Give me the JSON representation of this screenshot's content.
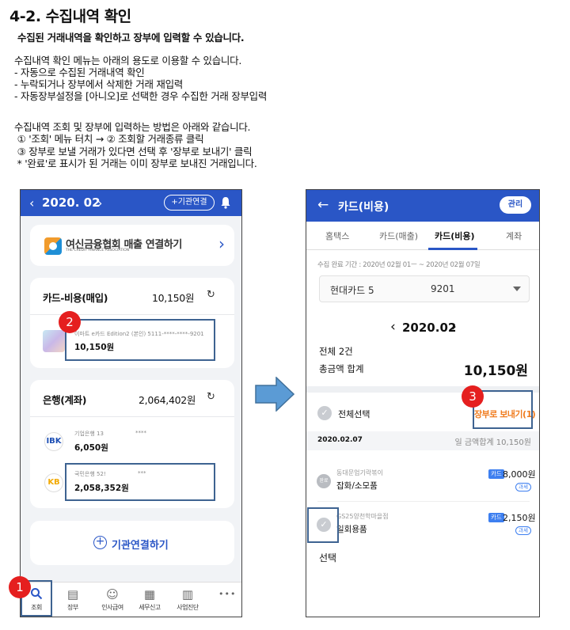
{
  "doc": {
    "title": "4-2. 수집내역 확인",
    "subtitle": "수집된 거래내역을 확인하고 장부에 입력할 수 있습니다.",
    "usage": [
      "수집내역 확인 메뉴는 아래의 용도로 이용할 수 있습니다.",
      "- 자동으로 수집된 거래내역 확인",
      "- 누락되거나 장부에서 삭제한 거래 재입력",
      "- 자동장부설정을 [아니오]로 선택한 경우 수집한 거래 장부입력"
    ],
    "method": [
      "수집내역 조회 및 장부에 입력하는 방법은 아래와 같습니다.",
      " ① '조회' 메뉴 터치 → ② 조회할 거래종류 클릭",
      " ③ 장부로 보낼 거래가 있다면 선택 후 '장부로 보내기' 클릭",
      " * '완료'로 표시가 된 거래는 이미 장부로 보내진 거래입니다."
    ]
  },
  "left_phone": {
    "header": {
      "prev_icon": "chevron-left-icon",
      "month": "2020. 02",
      "next_icon": "chevron-right-icon",
      "connect_label": "+기관연결",
      "bell_icon": "bell-icon"
    },
    "banner": {
      "text": "여신금융협회 매출 연결하기",
      "sub": "THE CREDIT FINANCE ASSOCIATION",
      "chevron": "›"
    },
    "card_section": {
      "title": "카드-비용(매입)",
      "amount": "10,150원",
      "refresh": "↻",
      "item": {
        "name": "이마트 e카드 Edition2 (본인) 5111-****-****-9201",
        "amount": "10,150원"
      }
    },
    "bank_section": {
      "title": "은행(계좌)",
      "amount": "2,064,402원",
      "refresh": "↻",
      "items": [
        {
          "name": "기업은행 13",
          "masked": "****",
          "amount": "6,050원",
          "logo": "IBK"
        },
        {
          "name": "국민은행 52!",
          "masked": "***",
          "amount": "2,058,352원",
          "logo": "KB"
        }
      ]
    },
    "add_button": {
      "icon": "+",
      "label": "기관연결하기"
    },
    "bottom_nav": [
      {
        "label": "조회",
        "icon": "⚲"
      },
      {
        "label": "장부",
        "icon": "▤"
      },
      {
        "label": "인사급여",
        "icon": "☺"
      },
      {
        "label": "세무신고",
        "icon": "▦"
      },
      {
        "label": "사업진단",
        "icon": "▥"
      },
      {
        "label": "",
        "icon": "•••"
      }
    ],
    "steps": [
      "1",
      "2"
    ]
  },
  "right_phone": {
    "header": {
      "back": "←",
      "title": "카드(비용)",
      "manage": "관리"
    },
    "tabs": [
      "홈택스",
      "카드(매출)",
      "카드(비용)",
      "계좌"
    ],
    "active_tab": 2,
    "period": "수집 완료 기간 : 2020년 02월 01ㅡ ~ 2020년 02월 07일",
    "card_select": {
      "name": "현대카드 5",
      "number": "9201"
    },
    "month": {
      "prev": "‹",
      "value": "2020.02",
      "next": "›"
    },
    "total_count": "전체 2건",
    "total_amount_label": "총금액 합계",
    "total_amount": "10,150원",
    "select_all": "전체선택",
    "send_button": "장부로 보내기(1)",
    "date_row": {
      "date": "2020.02.07",
      "summary": "일 금액합계 10,150원"
    },
    "transactions": [
      {
        "badge": "완료",
        "merchant": "동대문업기락볶이",
        "category": "잡화/소모품",
        "card": "카드",
        "amount": "8,000원",
        "tax": "과세"
      },
      {
        "badge": "✓",
        "merchant": "GS25양천학마을점",
        "category": "일회용품",
        "card": "카드",
        "amount": "2,150원",
        "tax": "과세"
      }
    ],
    "select_caption": "선택",
    "step": "3"
  },
  "colors": {
    "primary": "#2a56c6",
    "accent": "#f07c1f",
    "badge": "#e51f1f",
    "highlight": "#3e6391"
  }
}
